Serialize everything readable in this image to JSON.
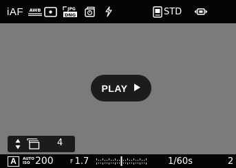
{
  "top_bar": {
    "focus_mode": "iAF",
    "white_balance_icon_label": "AWB",
    "metering_icon": "spot-metering-icon",
    "file_format_icon_label": "JPG DNG",
    "self_timer_icon": "self-timer-icon",
    "flash_icon": "flash-off-icon",
    "film_mode_icon": "film-mode-icon",
    "film_mode": "STD",
    "battery_icon": "battery-icon"
  },
  "viewfinder": {
    "play_button_label": "PLAY",
    "play_icon": "play-triangle-icon",
    "drive_mode": {
      "arrows_icon": "up-down-arrows-icon",
      "frames_icon": "continuous-shooting-icon",
      "count": "4"
    }
  },
  "bottom_bar": {
    "exposure_mode": "A",
    "iso_auto_label_top": "AUTO",
    "iso_auto_label_bottom": "ISO",
    "iso_value": "200",
    "aperture_prefix": "F",
    "aperture_value": "1.7",
    "exposure_scale_icon": "exposure-scale-icon",
    "shutter_speed": "1/60s",
    "remaining_frames": "2"
  },
  "colors": {
    "bar_background": "#050505",
    "viewfinder_background": "#7b7b7b",
    "button_background": "#1c1c1c",
    "foreground": "#ffffff"
  }
}
